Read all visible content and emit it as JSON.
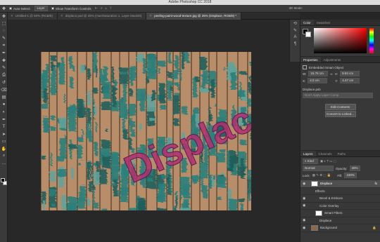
{
  "app": {
    "title": "Adobe Photoshop CC 2018"
  },
  "options_bar": {
    "auto_select_label": "Auto-Select:",
    "auto_select_value": "Layer",
    "show_transform_label": "Show Transform Controls",
    "mode_3d_label": "3D Mode:"
  },
  "tabs": [
    {
      "label": "Untitled-1 @ 50% (RGB/8)"
    },
    {
      "label": "displace.psd @ 25% (Hue/Saturation 1, Layer Mask/8)"
    },
    {
      "label": "peeling-paint-wood-texture.jpg @ 25% (Displace, RGB/8) *"
    }
  ],
  "toolbar": {
    "tools": [
      "move-tool-icon",
      "marquee-tool-icon",
      "lasso-tool-icon",
      "quick-select-tool-icon",
      "crop-tool-icon",
      "eyedropper-tool-icon",
      "healing-brush-tool-icon",
      "brush-tool-icon",
      "clone-stamp-tool-icon",
      "history-brush-tool-icon",
      "eraser-tool-icon",
      "gradient-tool-icon",
      "blur-tool-icon",
      "dodge-tool-icon",
      "pen-tool-icon",
      "type-tool-icon",
      "path-select-tool-icon",
      "shape-tool-icon",
      "hand-tool-icon",
      "zoom-tool-icon",
      "more-tools-icon"
    ],
    "glyphs": [
      "✥",
      "⬚",
      "◌",
      "✎",
      "⌗",
      "✒",
      "✚",
      "✎",
      "⎙",
      "↺",
      "⌫",
      "▤",
      "●",
      "◐",
      "✒",
      "T",
      "➤",
      "▭",
      "✋",
      "⌕",
      "…"
    ]
  },
  "canvas": {
    "overlay_text": "Displace",
    "overlay_color": "#b0306e"
  },
  "color_panel": {
    "tabs": [
      "Color",
      "Swatches"
    ]
  },
  "properties_panel": {
    "tabs": [
      "Properties",
      "Adjustments"
    ],
    "object_type": "Embedded Smart Object",
    "w_label": "W:",
    "w_value": "15.76 cm",
    "h_label": "H:",
    "h_value": "9.84 cm",
    "x_label": "X:",
    "x_value": "4.0 cm",
    "y_label": "Y:",
    "y_value": "4.47 cm",
    "filename": "Displace.psb",
    "layer_comp_placeholder": "Don't Apply Layer Comp",
    "edit_contents_label": "Edit Contents",
    "convert_label": "Convert to Linked..."
  },
  "layers_panel": {
    "tabs": [
      "Layers",
      "Channels",
      "Paths"
    ],
    "kind_filter": "Kind",
    "blend_mode": "Normal",
    "opacity_label": "Opacity:",
    "opacity_value": "40%",
    "lock_label": "Lock:",
    "fill_label": "Fill:",
    "fill_value": "100%",
    "layers": [
      {
        "name": "Displace",
        "fx": "fx",
        "selected": true,
        "indent": 0
      },
      {
        "name": "Effects",
        "indent": 1
      },
      {
        "name": "Bevel & Emboss",
        "indent": 2
      },
      {
        "name": "Color Overlay",
        "indent": 2
      },
      {
        "name": "Smart Filters",
        "indent": 1
      },
      {
        "name": "Displace",
        "indent": 2
      },
      {
        "name": "Background",
        "indent": 0,
        "locked": true
      }
    ]
  },
  "colors": {
    "teal": "#2a7f7a",
    "wood": "#b88d6a"
  }
}
